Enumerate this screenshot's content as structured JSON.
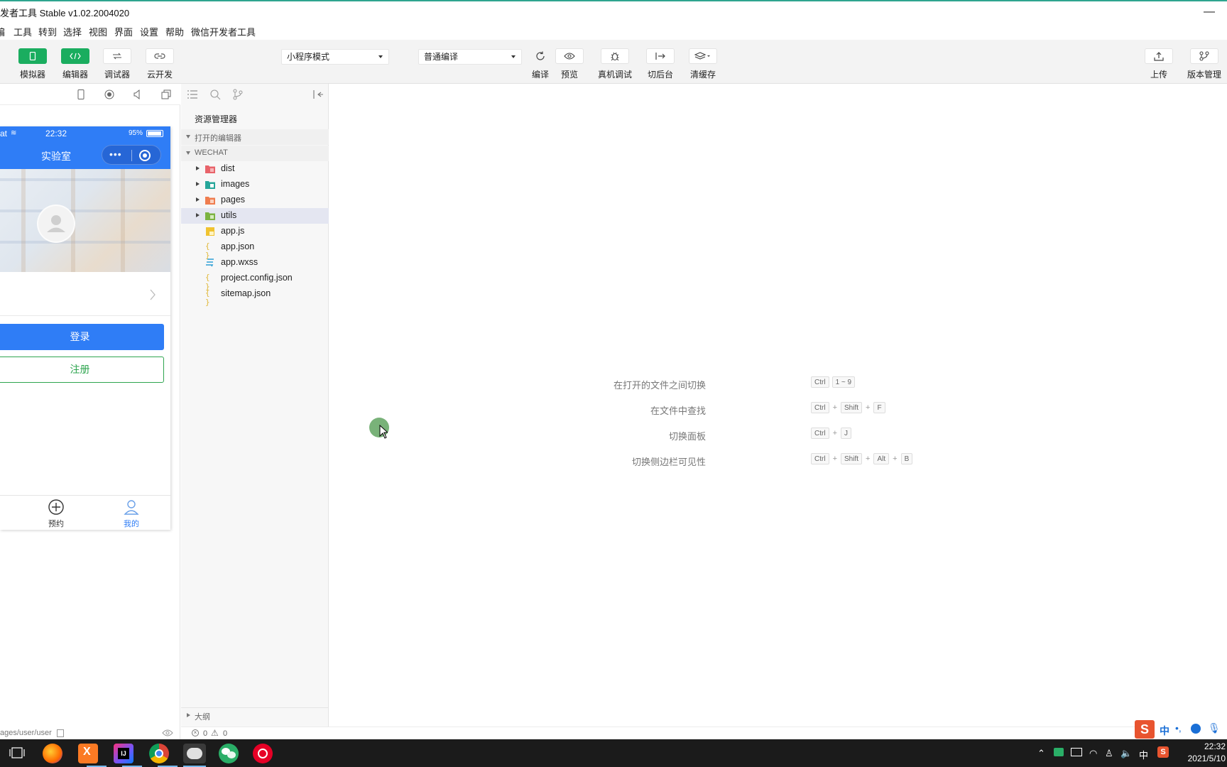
{
  "window": {
    "title": "发者工具 Stable v1.02.2004020",
    "minimize": "—"
  },
  "menu": [
    "编",
    "工具",
    "转到",
    "选择",
    "视图",
    "界面",
    "设置",
    "帮助",
    "微信开发者工具"
  ],
  "toolbar": {
    "left_buttons": [
      {
        "label": "模拟器",
        "icon": "phone-icon"
      },
      {
        "label": "编辑器",
        "icon": "code-icon"
      },
      {
        "label": "调试器",
        "icon": "debug-arrows-icon"
      },
      {
        "label": "云开发",
        "icon": "cloud-link-icon"
      }
    ],
    "mode_select": "小程序模式",
    "compile_select": "普通编译",
    "actions": [
      {
        "label": "编译",
        "icon": "refresh-icon"
      },
      {
        "label": "预览",
        "icon": "eye-icon"
      },
      {
        "label": "真机调试",
        "icon": "bug-icon"
      },
      {
        "label": "切后台",
        "icon": "switch-background-icon"
      },
      {
        "label": "清缓存",
        "icon": "layers-icon"
      }
    ],
    "right_actions": [
      {
        "label": "上传",
        "icon": "upload-icon"
      },
      {
        "label": "版本管理",
        "icon": "branch-icon"
      }
    ]
  },
  "simulator": {
    "status_carrier": "at",
    "status_time": "22:32",
    "status_battery": "95%",
    "nav_title": "实验室",
    "login_label": "登录",
    "register_label": "注册",
    "tabs": [
      {
        "label": "预约",
        "icon": "plus-circle-icon"
      },
      {
        "label": "我的",
        "icon": "person-icon"
      }
    ],
    "path": "ages/user/user",
    "accent": "#2f7df6",
    "register_color": "#2ea54f"
  },
  "explorer": {
    "title": "资源管理器",
    "open_editors": "打开的编辑器",
    "project": "WECHAT",
    "items": [
      {
        "name": "dist",
        "type": "folder",
        "color": "#e8636a"
      },
      {
        "name": "images",
        "type": "folder",
        "color": "#26a69a"
      },
      {
        "name": "pages",
        "type": "folder",
        "color": "#ef7d4f"
      },
      {
        "name": "utils",
        "type": "folder",
        "color": "#7cb342"
      },
      {
        "name": "app.js",
        "type": "js"
      },
      {
        "name": "app.json",
        "type": "json"
      },
      {
        "name": "app.wxss",
        "type": "wxss"
      },
      {
        "name": "project.config.json",
        "type": "json"
      },
      {
        "name": "sitemap.json",
        "type": "json"
      }
    ],
    "outline": "大纲"
  },
  "editor": {
    "hints": [
      {
        "label": "在打开的文件之间切换",
        "keys": [
          "Ctrl",
          "1 ~ 9"
        ],
        "joined": false
      },
      {
        "label": "在文件中查找",
        "keys": [
          "Ctrl",
          "Shift",
          "F"
        ],
        "joined": true
      },
      {
        "label": "切换面板",
        "keys": [
          "Ctrl",
          "J"
        ],
        "joined": true
      },
      {
        "label": "切换侧边栏可见性",
        "keys": [
          "Ctrl",
          "Shift",
          "Alt",
          "B"
        ],
        "joined": true
      }
    ]
  },
  "statusbar": {
    "errors": "0",
    "warnings": "0"
  },
  "ime": {
    "label": "中"
  },
  "taskbar": {
    "apps": [
      "task-view-icon",
      "firefox-icon",
      "xampp-icon",
      "intellij-icon",
      "chrome-icon",
      "wechat-devtools-icon",
      "wechat-green-icon",
      "netease-music-icon"
    ],
    "tray_lang": "中",
    "time": "22:32",
    "date": "2021/5/10"
  }
}
